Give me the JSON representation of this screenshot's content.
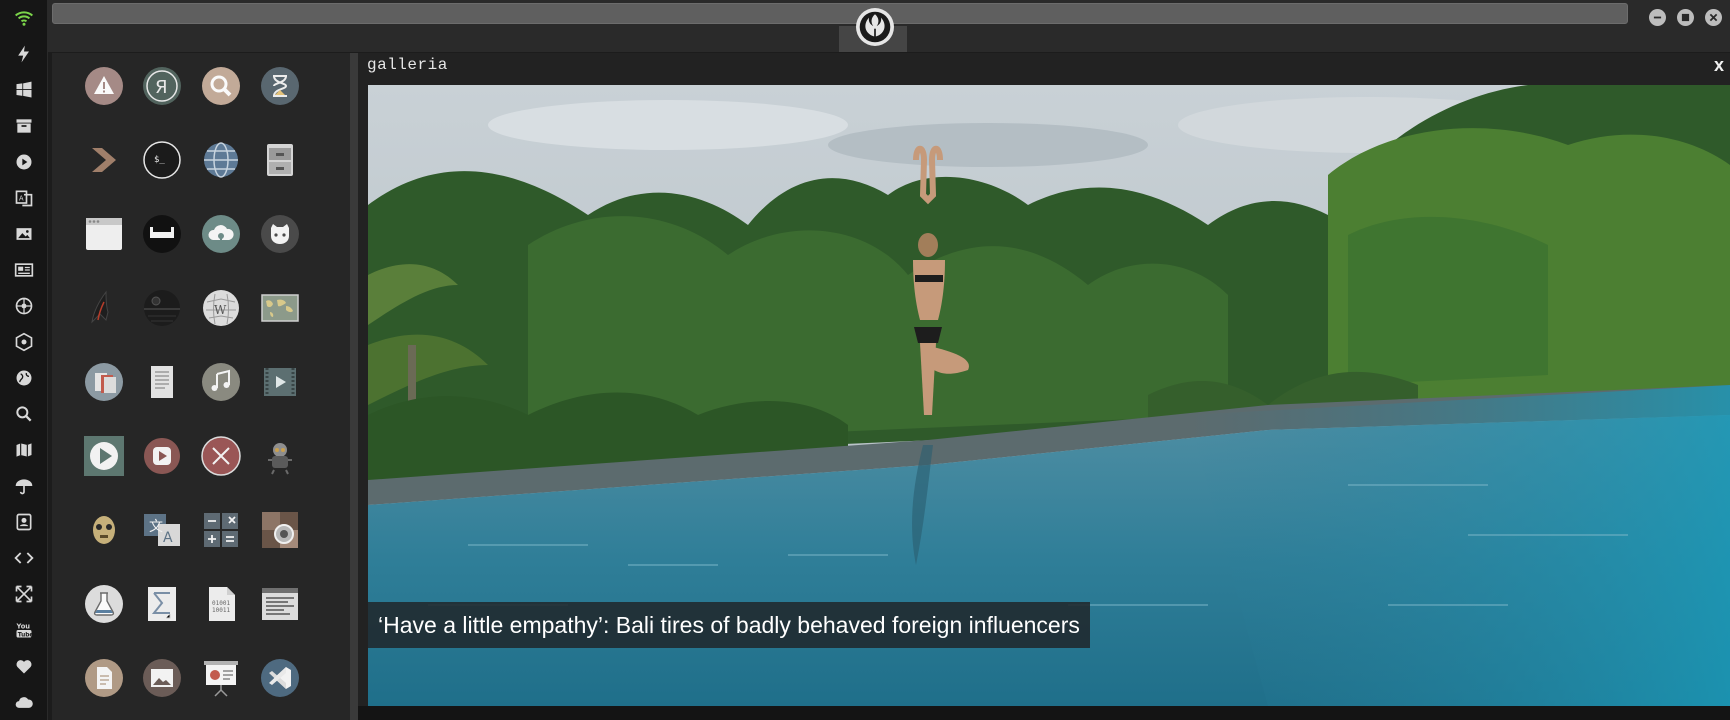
{
  "dock": {
    "items": [
      "wifi-icon",
      "bolt-icon",
      "windows-icon",
      "archive-icon",
      "play-icon",
      "translate-icon",
      "image-icon",
      "news-icon",
      "rebel-icon",
      "empire-icon",
      "globe-icon",
      "search-icon",
      "map-icon",
      "umbrella-icon",
      "contacts-icon",
      "code-icon",
      "expand-icon",
      "youtube-icon",
      "heart-icon",
      "cloud-icon"
    ],
    "accent": "#7bd44a"
  },
  "topbar": {
    "logo": "rebel-alliance-icon",
    "buttons": [
      "minimize-icon",
      "maximize-icon",
      "close-icon"
    ]
  },
  "launcher": {
    "apps": [
      [
        "warning-icon",
        "yandex-icon",
        "search-icon",
        "hourglass-icon"
      ],
      [
        "chevron-icon",
        "terminal-icon",
        "globe-icon",
        "file-cabinet-icon"
      ],
      [
        "window-icon",
        "tie-fighter-icon",
        "cloud-upload-icon",
        "github-icon"
      ],
      [
        "starfleet-icon",
        "death-star-icon",
        "wikipedia-icon",
        "world-map-icon"
      ],
      [
        "file-manager-icon",
        "document-icon",
        "music-icon",
        "video-icon"
      ],
      [
        "play-button-icon",
        "media-player-icon",
        "close-circle-icon",
        "robot-icon"
      ],
      [
        "c3po-icon",
        "translate-icon",
        "calculator-icon",
        "photo-viewer-icon"
      ],
      [
        "flask-icon",
        "sigma-icon",
        "binary-file-icon",
        "text-editor-icon"
      ],
      [
        "notes-icon",
        "image-icon",
        "presentation-icon",
        "vscode-icon"
      ]
    ]
  },
  "gallery": {
    "title": "galleria",
    "close": "x",
    "caption": "‘Have a little empathy’: Bali tires of badly behaved foreign influencers"
  }
}
